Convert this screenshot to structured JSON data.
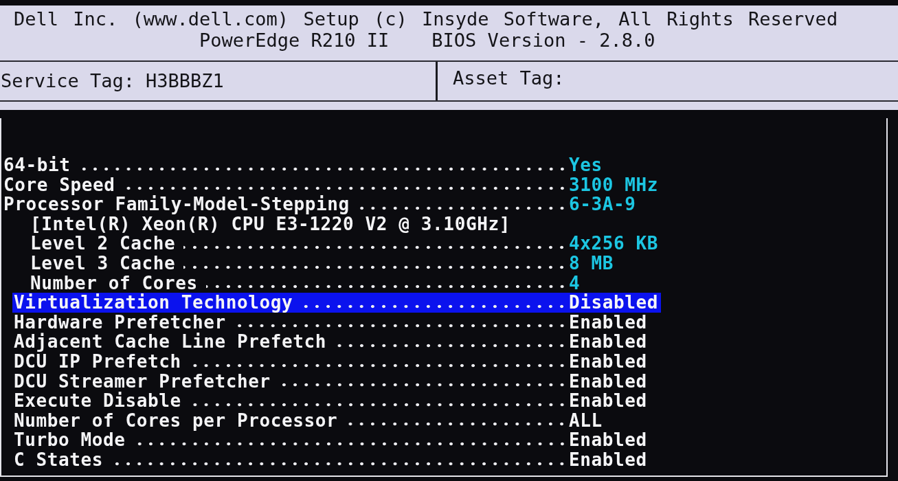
{
  "header": {
    "copyright": "Dell Inc. (www.dell.com) Setup (c) Insyde Software, All Rights Reserved",
    "model": "PowerEdge R210 II",
    "bios_version": "BIOS Version - 2.8.0"
  },
  "tags": {
    "service_tag": {
      "label": "Service Tag:",
      "value": "H3BBBZ1"
    },
    "asset_tag": {
      "label": "Asset Tag:"
    }
  },
  "processor_info": [
    {
      "kind": "field",
      "label": "64-bit",
      "value": "Yes"
    },
    {
      "kind": "field",
      "label": "Core Speed",
      "value": "3100 MHz"
    },
    {
      "kind": "field",
      "label": "Processor Family-Model-Stepping",
      "value": "6-3A-9",
      "children": [
        {
          "kind": "note",
          "label": "[Intel(R) Xeon(R) CPU E3-1220 V2 @ 3.10GHz]"
        },
        {
          "kind": "field",
          "label": "Level 2 Cache",
          "value": "4x256 KB"
        },
        {
          "kind": "field",
          "label": "Level 3 Cache",
          "value": "8 MB"
        },
        {
          "kind": "field",
          "label": "Number of Cores",
          "value": "4"
        }
      ]
    }
  ],
  "settings": [
    {
      "label": "Virtualization Technology",
      "value": "Disabled",
      "selected": true
    },
    {
      "label": "Hardware Prefetcher",
      "value": "Enabled",
      "selected": false
    },
    {
      "label": "Adjacent Cache Line Prefetch",
      "value": "Enabled",
      "selected": false
    },
    {
      "label": "DCU IP Prefetch",
      "value": "Enabled",
      "selected": false
    },
    {
      "label": "DCU Streamer Prefetcher",
      "value": "Enabled",
      "selected": false
    },
    {
      "label": "Execute Disable",
      "value": "Enabled",
      "selected": false
    },
    {
      "label": "Number of Cores per Processor",
      "value": "ALL",
      "selected": false
    },
    {
      "label": "Turbo Mode",
      "value": "Enabled",
      "selected": false
    },
    {
      "label": "C States",
      "value": "Enabled",
      "selected": false
    }
  ]
}
